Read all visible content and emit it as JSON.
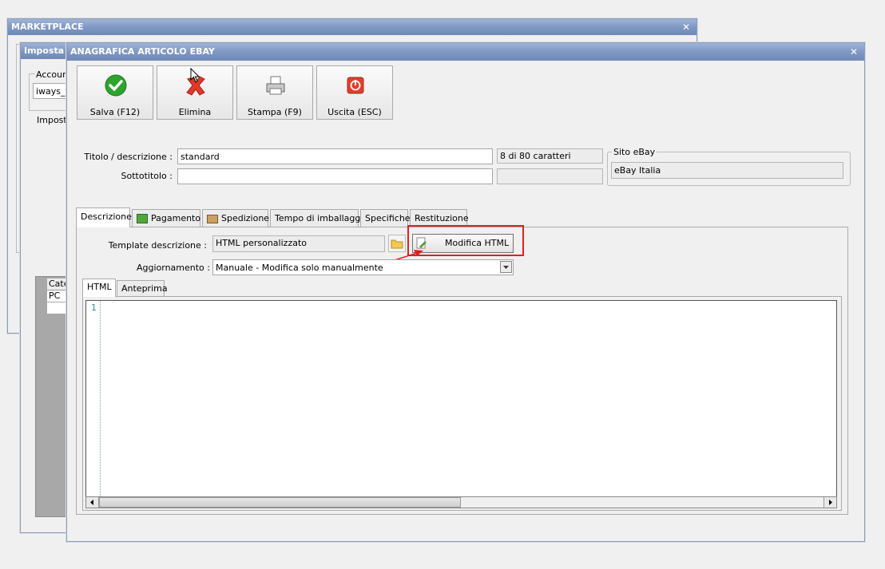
{
  "marketplace_window": {
    "title": "MARKETPLACE",
    "inner_title": "Imposta",
    "account_label": "Account",
    "account_value": "iways_t",
    "tab_label": "Imposta",
    "grid_header": "Cate",
    "grid_row": "PC"
  },
  "main_window": {
    "title": "ANAGRAFICA ARTICOLO EBAY",
    "close": "×"
  },
  "toolbar": {
    "save_label": "Salva (F12)",
    "delete_label": "Elimina",
    "print_label": "Stampa (F9)",
    "exit_label": "Uscita (ESC)"
  },
  "form": {
    "title_label": "Titolo / descrizione :",
    "title_value": "standard",
    "title_counter": "8 di 80 caratteri",
    "subtitle_label": "Sottotitolo :",
    "subtitle_value": "",
    "ebay_site_group": "Sito eBay",
    "ebay_site_value": "eBay Italia"
  },
  "tabs": [
    {
      "label": "Descrizione"
    },
    {
      "label": "Pagamento"
    },
    {
      "label": "Spedizione"
    },
    {
      "label": "Tempo di imballaggio"
    },
    {
      "label": "Specifiche"
    },
    {
      "label": "Restituzione"
    }
  ],
  "description": {
    "template_label": "Template descrizione :",
    "template_value": "HTML personalizzato",
    "edit_html_label": "Modifica HTML",
    "update_label": "Aggiornamento :",
    "update_value": "Manuale - Modifica solo manualmente"
  },
  "subtabs": [
    {
      "label": "HTML"
    },
    {
      "label": "Anteprima"
    }
  ],
  "editor": {
    "line_number": "1"
  },
  "colors": {
    "titlebar": "#7f98c4",
    "highlight": "#e02020"
  }
}
